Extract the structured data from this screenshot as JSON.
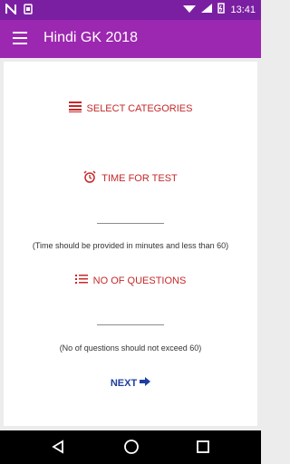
{
  "status_bar": {
    "time": "13:41"
  },
  "app_bar": {
    "title": "Hindi GK 2018"
  },
  "main": {
    "select_categories": "SELECT CATEGORIES",
    "time_for_test": "TIME FOR TEST",
    "time_hint": "(Time should be provided in minutes and less than 60)",
    "no_of_questions": "NO OF QUESTIONS",
    "questions_hint": "(No of questions should not exceed 60)",
    "next": "NEXT"
  },
  "icons": {
    "menu": "hamburger-icon",
    "categories": "list-icon",
    "time": "alarm-icon",
    "questions": "list-numbered-icon",
    "next": "arrow-right-icon",
    "back": "back-triangle-icon",
    "home": "home-circle-icon",
    "recent": "recents-square-icon"
  },
  "colors": {
    "status_bar": "#7b1fa2",
    "app_bar": "#9c27b0",
    "accent_red": "#c62828",
    "next_blue": "#1e3fa0"
  }
}
